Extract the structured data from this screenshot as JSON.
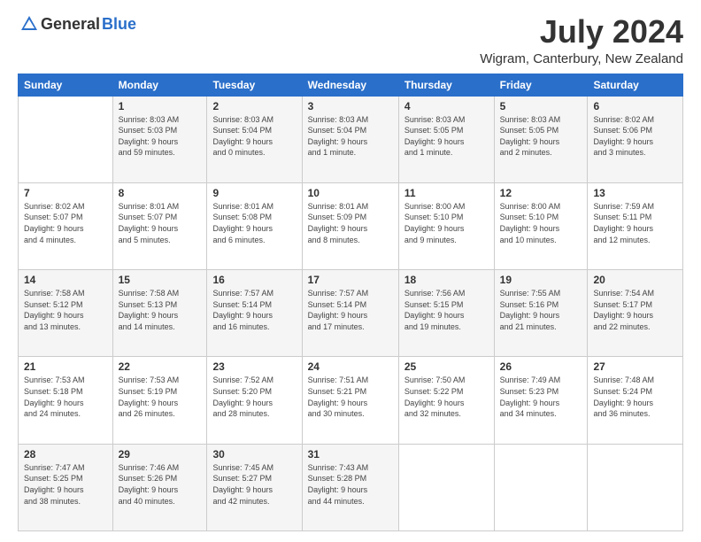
{
  "header": {
    "logo_general": "General",
    "logo_blue": "Blue",
    "month_title": "July 2024",
    "location": "Wigram, Canterbury, New Zealand"
  },
  "days_of_week": [
    "Sunday",
    "Monday",
    "Tuesday",
    "Wednesday",
    "Thursday",
    "Friday",
    "Saturday"
  ],
  "weeks": [
    [
      {
        "day": "",
        "info": ""
      },
      {
        "day": "1",
        "info": "Sunrise: 8:03 AM\nSunset: 5:03 PM\nDaylight: 9 hours\nand 59 minutes."
      },
      {
        "day": "2",
        "info": "Sunrise: 8:03 AM\nSunset: 5:04 PM\nDaylight: 9 hours\nand 0 minutes."
      },
      {
        "day": "3",
        "info": "Sunrise: 8:03 AM\nSunset: 5:04 PM\nDaylight: 9 hours\nand 1 minute."
      },
      {
        "day": "4",
        "info": "Sunrise: 8:03 AM\nSunset: 5:05 PM\nDaylight: 9 hours\nand 1 minute."
      },
      {
        "day": "5",
        "info": "Sunrise: 8:03 AM\nSunset: 5:05 PM\nDaylight: 9 hours\nand 2 minutes."
      },
      {
        "day": "6",
        "info": "Sunrise: 8:02 AM\nSunset: 5:06 PM\nDaylight: 9 hours\nand 3 minutes."
      }
    ],
    [
      {
        "day": "7",
        "info": "Sunrise: 8:02 AM\nSunset: 5:07 PM\nDaylight: 9 hours\nand 4 minutes."
      },
      {
        "day": "8",
        "info": "Sunrise: 8:01 AM\nSunset: 5:07 PM\nDaylight: 9 hours\nand 5 minutes."
      },
      {
        "day": "9",
        "info": "Sunrise: 8:01 AM\nSunset: 5:08 PM\nDaylight: 9 hours\nand 6 minutes."
      },
      {
        "day": "10",
        "info": "Sunrise: 8:01 AM\nSunset: 5:09 PM\nDaylight: 9 hours\nand 8 minutes."
      },
      {
        "day": "11",
        "info": "Sunrise: 8:00 AM\nSunset: 5:10 PM\nDaylight: 9 hours\nand 9 minutes."
      },
      {
        "day": "12",
        "info": "Sunrise: 8:00 AM\nSunset: 5:10 PM\nDaylight: 9 hours\nand 10 minutes."
      },
      {
        "day": "13",
        "info": "Sunrise: 7:59 AM\nSunset: 5:11 PM\nDaylight: 9 hours\nand 12 minutes."
      }
    ],
    [
      {
        "day": "14",
        "info": "Sunrise: 7:58 AM\nSunset: 5:12 PM\nDaylight: 9 hours\nand 13 minutes."
      },
      {
        "day": "15",
        "info": "Sunrise: 7:58 AM\nSunset: 5:13 PM\nDaylight: 9 hours\nand 14 minutes."
      },
      {
        "day": "16",
        "info": "Sunrise: 7:57 AM\nSunset: 5:14 PM\nDaylight: 9 hours\nand 16 minutes."
      },
      {
        "day": "17",
        "info": "Sunrise: 7:57 AM\nSunset: 5:14 PM\nDaylight: 9 hours\nand 17 minutes."
      },
      {
        "day": "18",
        "info": "Sunrise: 7:56 AM\nSunset: 5:15 PM\nDaylight: 9 hours\nand 19 minutes."
      },
      {
        "day": "19",
        "info": "Sunrise: 7:55 AM\nSunset: 5:16 PM\nDaylight: 9 hours\nand 21 minutes."
      },
      {
        "day": "20",
        "info": "Sunrise: 7:54 AM\nSunset: 5:17 PM\nDaylight: 9 hours\nand 22 minutes."
      }
    ],
    [
      {
        "day": "21",
        "info": "Sunrise: 7:53 AM\nSunset: 5:18 PM\nDaylight: 9 hours\nand 24 minutes."
      },
      {
        "day": "22",
        "info": "Sunrise: 7:53 AM\nSunset: 5:19 PM\nDaylight: 9 hours\nand 26 minutes."
      },
      {
        "day": "23",
        "info": "Sunrise: 7:52 AM\nSunset: 5:20 PM\nDaylight: 9 hours\nand 28 minutes."
      },
      {
        "day": "24",
        "info": "Sunrise: 7:51 AM\nSunset: 5:21 PM\nDaylight: 9 hours\nand 30 minutes."
      },
      {
        "day": "25",
        "info": "Sunrise: 7:50 AM\nSunset: 5:22 PM\nDaylight: 9 hours\nand 32 minutes."
      },
      {
        "day": "26",
        "info": "Sunrise: 7:49 AM\nSunset: 5:23 PM\nDaylight: 9 hours\nand 34 minutes."
      },
      {
        "day": "27",
        "info": "Sunrise: 7:48 AM\nSunset: 5:24 PM\nDaylight: 9 hours\nand 36 minutes."
      }
    ],
    [
      {
        "day": "28",
        "info": "Sunrise: 7:47 AM\nSunset: 5:25 PM\nDaylight: 9 hours\nand 38 minutes."
      },
      {
        "day": "29",
        "info": "Sunrise: 7:46 AM\nSunset: 5:26 PM\nDaylight: 9 hours\nand 40 minutes."
      },
      {
        "day": "30",
        "info": "Sunrise: 7:45 AM\nSunset: 5:27 PM\nDaylight: 9 hours\nand 42 minutes."
      },
      {
        "day": "31",
        "info": "Sunrise: 7:43 AM\nSunset: 5:28 PM\nDaylight: 9 hours\nand 44 minutes."
      },
      {
        "day": "",
        "info": ""
      },
      {
        "day": "",
        "info": ""
      },
      {
        "day": "",
        "info": ""
      }
    ]
  ]
}
